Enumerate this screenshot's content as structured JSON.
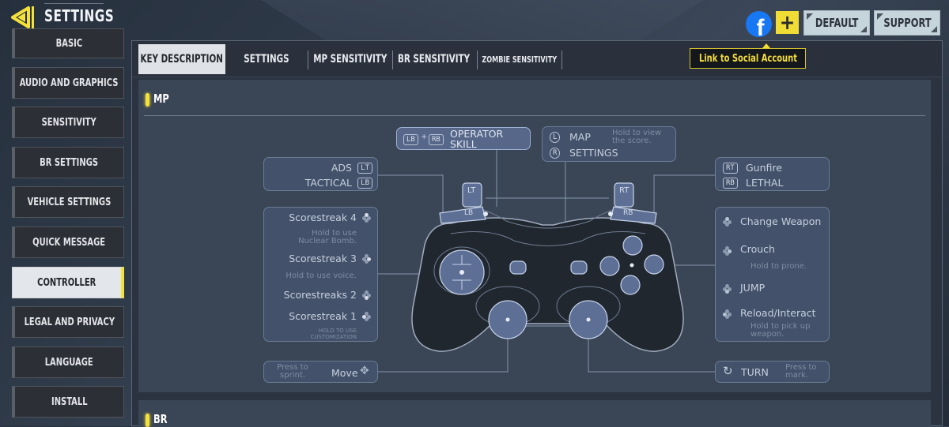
{
  "header": {
    "title": "SETTINGS",
    "back_icon": "back-arrow-icon"
  },
  "sidebar": {
    "items": [
      {
        "label": "BASIC",
        "active": false
      },
      {
        "label": "AUDIO AND GRAPHICS",
        "active": false
      },
      {
        "label": "SENSITIVITY",
        "active": false
      },
      {
        "label": "BR SETTINGS",
        "active": false
      },
      {
        "label": "VEHICLE SETTINGS",
        "active": false
      },
      {
        "label": "QUICK MESSAGE",
        "active": false
      },
      {
        "label": "CONTROLLER",
        "active": true
      },
      {
        "label": "LEGAL AND PRIVACY",
        "active": false
      },
      {
        "label": "LANGUAGE",
        "active": false
      },
      {
        "label": "INSTALL",
        "active": false
      }
    ]
  },
  "topbar": {
    "facebook_glyph": "f",
    "plus_glyph": "+",
    "default_label": "DEFAULT",
    "support_label": "SUPPORT",
    "tooltip": "Link to Social Account"
  },
  "tabs": [
    {
      "label": "KEY DESCRIPTION",
      "active": true
    },
    {
      "label": "SETTINGS",
      "active": false
    },
    {
      "label": "MP SENSITIVITY",
      "active": false
    },
    {
      "label": "BR SENSITIVITY",
      "active": false
    },
    {
      "label": "ZOMBIE SENSITIVITY",
      "active": false
    }
  ],
  "sections": {
    "mp": "MP",
    "br": "BR"
  },
  "controller": {
    "operator": {
      "key1": "LB",
      "plus": "+",
      "key2": "RB",
      "label_line1": "OPERATOR",
      "label_line2": "SKILL"
    },
    "map": {
      "key": "L",
      "label": "MAP",
      "hint": "Hold to view the score."
    },
    "settings": {
      "key": "R",
      "label": "SETTINGS"
    },
    "ads": {
      "label": "ADS",
      "key": "LT"
    },
    "tactical": {
      "label": "TACTICAL",
      "key": "LB"
    },
    "gunfire": {
      "key": "RT",
      "label": "Gunfire"
    },
    "lethal": {
      "key": "RB",
      "label": "LETHAL"
    },
    "dpad": [
      {
        "label": "Scorestreak 4",
        "hint": "Hold to use Nuclear Bomb."
      },
      {
        "label": "Scorestreak 3",
        "hint": "Hold to use voice."
      },
      {
        "label": "Scorestreaks 2",
        "hint": ""
      },
      {
        "label": "Scorestreak 1",
        "hint": "HOLD TO USE CUSTOMIZATION"
      }
    ],
    "face": [
      {
        "label": "Change Weapon",
        "hint": ""
      },
      {
        "label": "Crouch",
        "hint": "Hold to prone."
      },
      {
        "label": "JUMP",
        "hint": ""
      },
      {
        "label": "Reload/Interact",
        "hint": "Hold to pick up weapon."
      }
    ],
    "left_stick": {
      "hint": "Press to sprint.",
      "label": "Move"
    },
    "right_stick": {
      "label": "TURN",
      "hint": "Press to mark."
    },
    "bumper_labels": {
      "lt": "LT",
      "lb": "LB",
      "rt": "RT",
      "rb": "RB"
    }
  }
}
